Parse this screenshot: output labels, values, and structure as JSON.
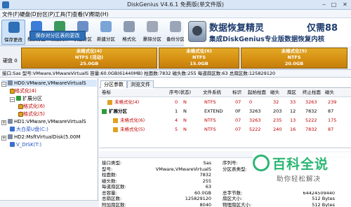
{
  "window": {
    "title": "DiskGenius V4.6.1 免费版(单文件版)",
    "buttons": [
      "minimize-icon",
      "maximize-icon",
      "close-icon"
    ]
  },
  "menu": [
    "文件(F)",
    "硬盘(D)",
    "分区(P)",
    "工具(T)",
    "查看(V)",
    "帮助(H)"
  ],
  "toolbar": {
    "buttons": [
      {
        "label": "保存更改",
        "icon": "save-icon",
        "color": "#2f6fb7"
      },
      {
        "label": "搜索分区",
        "icon": "search-icon",
        "color": "#3b7dd8"
      },
      {
        "label": "恢复文件",
        "icon": "recover-icon",
        "color": "#3b9a5a"
      },
      {
        "label": "快速分区",
        "icon": "quick-partition-icon",
        "color": "#6a8fc7"
      },
      {
        "label": "新建分区",
        "icon": "new-partition-icon",
        "color": "#7aa5d6"
      },
      {
        "label": "格式化",
        "icon": "format-icon",
        "color": "#8d9bb0"
      },
      {
        "label": "删除分区",
        "icon": "delete-icon",
        "color": "#a0a8b5"
      },
      {
        "label": "备份分区",
        "icon": "backup-icon",
        "color": "#9aa6b8"
      }
    ],
    "tooltip": "保存对分区表的更改"
  },
  "banner": {
    "line1": "数据恢复精灵",
    "line2": "集成DiskGenius专业版数据恢复内核",
    "line3": "仅需88"
  },
  "diskmap": {
    "label": "硬盘 0",
    "partitions": [
      {
        "name": "未格式化(4)",
        "fs": "NTFS (活动)",
        "size": "25.0GB",
        "fraction": 0.42
      },
      {
        "name": "未格式化(6)",
        "fs": "NTFS",
        "size": "15.0GB",
        "fraction": 0.25
      },
      {
        "name": "未格式化(5)",
        "fs": "NTFS",
        "size": "20.0GB",
        "fraction": 0.33
      }
    ]
  },
  "infoline": "接口:Sas  型号:VMware,VMwareVirtualS  容量:60.0GB(61440MB)  柱面数:7832  磁头数:255  每道扇区数:63  总扇区数:125829120",
  "tree": [
    {
      "text": "HD0:VMware,VMwareVirtualS",
      "level": 0,
      "kind": "disk",
      "expander": "−",
      "selected": true
    },
    {
      "text": "未格式化(4)",
      "level": 1,
      "kind": "part",
      "cls": "red"
    },
    {
      "text": "扩展分区",
      "level": 1,
      "kind": "ext",
      "expander": "−"
    },
    {
      "text": "未格式化(6)",
      "level": 2,
      "kind": "part",
      "cls": "red"
    },
    {
      "text": "未格式化(5)",
      "level": 2,
      "kind": "part",
      "cls": "red"
    },
    {
      "text": "HD1:VMware,VMwareVirtualS",
      "level": 0,
      "kind": "disk",
      "expander": "+"
    },
    {
      "text": "大白菜U盘(C:)",
      "level": 1,
      "kind": "blue",
      "cls": "blue"
    },
    {
      "text": "HD2:MsftVirtualDisk(5.00M",
      "level": 0,
      "kind": "disk",
      "expander": "+"
    },
    {
      "text": "V_DISK(T:)",
      "level": 1,
      "kind": "blue",
      "cls": "blue"
    }
  ],
  "tabs": [
    "分区参数",
    "浏览文件"
  ],
  "table": {
    "headers": [
      "卷标",
      "序号(状态)",
      "文件系统",
      "标识",
      "起始柱面",
      "磁头",
      "扇区",
      "终止柱面",
      "磁头"
    ],
    "rows": [
      {
        "name": "未格式化(4)",
        "seq": "0",
        "state": "N",
        "fs": "NTFS",
        "id": "07",
        "sc": "0",
        "sh": "32",
        "ss": "33",
        "ec": "3263",
        "eh": "239",
        "cls": "red",
        "indent": 1
      },
      {
        "name": "扩展分区",
        "seq": "1",
        "state": "N",
        "fs": "EXTEND",
        "id": "0F",
        "sc": "3263",
        "sh": "203",
        "ss": "12",
        "ec": "7832",
        "eh": "87",
        "cls": "",
        "indent": 0
      },
      {
        "name": "未格式化(6)",
        "seq": "4",
        "state": "N",
        "fs": "NTFS",
        "id": "07",
        "sc": "3263",
        "sh": "235",
        "ss": "13",
        "ec": "5222",
        "eh": "175",
        "cls": "red",
        "indent": 2
      },
      {
        "name": "未格式化(5)",
        "seq": "5",
        "state": "N",
        "fs": "NTFS",
        "id": "07",
        "sc": "5222",
        "sh": "240",
        "ss": "16",
        "ec": "7832",
        "eh": "87",
        "cls": "red",
        "indent": 2
      }
    ]
  },
  "details": {
    "left": [
      {
        "k": "接口类型:",
        "v": "Sas"
      },
      {
        "k": "型号:",
        "v": "VMware,VMwareVirtualS"
      },
      {
        "k": "柱面数:",
        "v": "7832"
      },
      {
        "k": "磁头数:",
        "v": "255"
      },
      {
        "k": "每道扇区数:",
        "v": "63"
      },
      {
        "k": "总容量:",
        "v": "60.0GB"
      },
      {
        "k": "总扇区数:",
        "v": "125829120"
      },
      {
        "k": "附加扇区数:",
        "v": "8040"
      }
    ],
    "right": [
      {
        "k": "序列号:",
        "v": ""
      },
      {
        "k": "分区表类型:",
        "v": ""
      },
      {
        "k": "",
        "v": ""
      },
      {
        "k": "",
        "v": ""
      },
      {
        "k": "",
        "v": ""
      },
      {
        "k": "总字节数:",
        "v": "64424509440"
      },
      {
        "k": "扇区大小:",
        "v": "512 Bytes"
      },
      {
        "k": "物理扇区大小:",
        "v": "512 Bytes"
      }
    ]
  },
  "watermark": {
    "title": "百科全说",
    "subtitle": "助你轻松解决"
  }
}
